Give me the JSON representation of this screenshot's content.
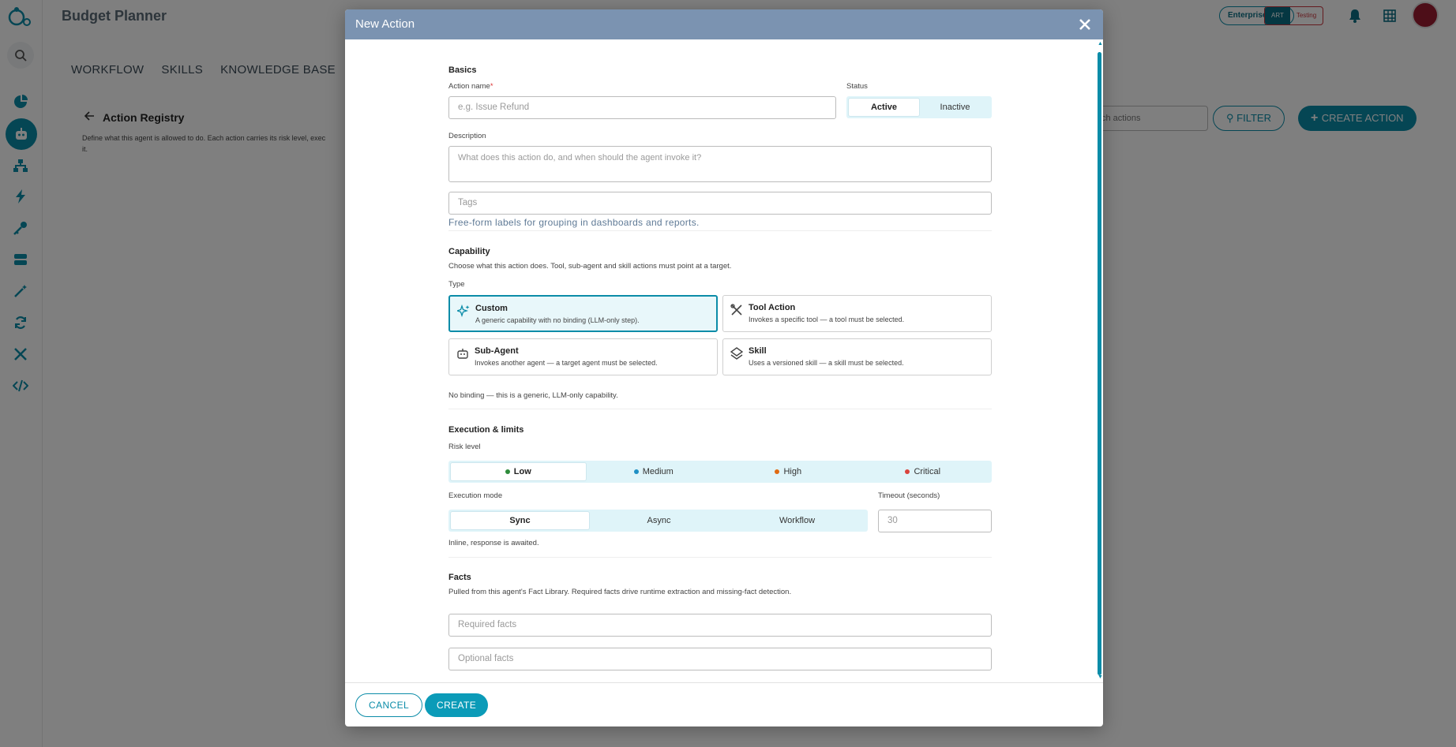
{
  "app": {
    "title": "Budget Planner",
    "plan_badge": "Enterprise Plan",
    "env_art": "ART",
    "env_testing": "Testing",
    "brand_color": "#0b8ca8"
  },
  "sidebar": {
    "icons": [
      "logo-icon",
      "search-icon",
      "pie-chart-icon",
      "robot-icon",
      "hierarchy-icon",
      "bolt-icon",
      "key-icon",
      "database-icon",
      "magic-wand-icon",
      "sync-icon",
      "tools-icon",
      "code-icon"
    ]
  },
  "main": {
    "tabs": [
      "WORKFLOW",
      "SKILLS",
      "KNOWLEDGE BASE"
    ],
    "registry_title": "Action Registry",
    "registry_desc_1": "Define what this agent is allowed to do. Each action carries its risk level, exec",
    "registry_desc_2": "it.",
    "search_placeholder": "ch actions",
    "filter_label": "FILTER",
    "create_action_label": "CREATE ACTION"
  },
  "modal": {
    "title": "New Action",
    "basics": {
      "title": "Basics",
      "action_name_label": "Action name",
      "required_mark": "*",
      "action_name_placeholder": "e.g. Issue Refund",
      "status_label": "Status",
      "status_options": [
        "Active",
        "Inactive"
      ],
      "status_selected": "Active",
      "description_label": "Description",
      "description_placeholder": "What does this action do, and when should the agent invoke it?",
      "tags_placeholder": "Tags",
      "tags_helper": "Free-form labels for grouping in dashboards and reports."
    },
    "capability": {
      "title": "Capability",
      "subtitle": "Choose what this action does. Tool, sub-agent and skill actions must point at a target.",
      "type_label": "Type",
      "types": [
        {
          "title": "Custom",
          "desc": "A generic capability with no binding (LLM-only step).",
          "icon": "sparkles-icon"
        },
        {
          "title": "Tool Action",
          "desc": "Invokes a specific tool — a tool must be selected.",
          "icon": "tools-icon"
        },
        {
          "title": "Sub-Agent",
          "desc": "Invokes another agent — a target agent must be selected.",
          "icon": "robot-icon"
        },
        {
          "title": "Skill",
          "desc": "Uses a versioned skill — a skill must be selected.",
          "icon": "layers-icon"
        }
      ],
      "selected_type": "Custom",
      "binding_note": "No binding — this is a generic, LLM-only capability."
    },
    "execution": {
      "title": "Execution & limits",
      "risk_label": "Risk level",
      "risk_levels": [
        {
          "label": "Low",
          "color": "#2e8b3a"
        },
        {
          "label": "Medium",
          "color": "#1e8fc4"
        },
        {
          "label": "High",
          "color": "#e06a12"
        },
        {
          "label": "Critical",
          "color": "#d9433c"
        }
      ],
      "risk_selected": "Low",
      "mode_label": "Execution mode",
      "modes": [
        "Sync",
        "Async",
        "Workflow"
      ],
      "mode_selected": "Sync",
      "timeout_label": "Timeout (seconds)",
      "timeout_placeholder": "30",
      "mode_helper": "Inline, response is awaited."
    },
    "facts": {
      "title": "Facts",
      "subtitle": "Pulled from this agent's Fact Library. Required facts drive runtime extraction and missing-fact detection.",
      "required_placeholder": "Required facts",
      "optional_placeholder": "Optional facts"
    },
    "footer": {
      "cancel": "CANCEL",
      "create": "CREATE"
    }
  }
}
